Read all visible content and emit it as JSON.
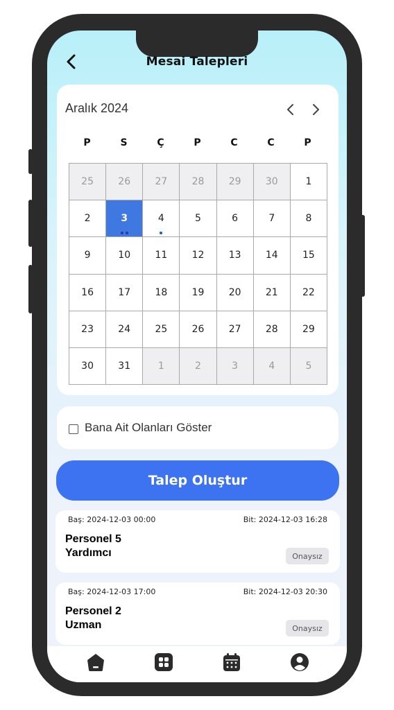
{
  "header": {
    "title": "Mesai Talepleri",
    "back_icon": "back-chevron-icon"
  },
  "calendar": {
    "month_label": "Aralık 2024",
    "prev_icon": "chevron-left-icon",
    "next_icon": "chevron-right-icon",
    "weekdays": [
      "P",
      "S",
      "Ç",
      "P",
      "C",
      "C",
      "P"
    ],
    "days": [
      {
        "label": "25",
        "other": true,
        "dots": 0
      },
      {
        "label": "26",
        "other": true,
        "dots": 0
      },
      {
        "label": "27",
        "other": true,
        "dots": 0
      },
      {
        "label": "28",
        "other": true,
        "dots": 0
      },
      {
        "label": "29",
        "other": true,
        "dots": 0
      },
      {
        "label": "30",
        "other": true,
        "dots": 0
      },
      {
        "label": "1",
        "other": false,
        "dots": 0
      },
      {
        "label": "2",
        "other": false,
        "dots": 0
      },
      {
        "label": "3",
        "other": false,
        "today": true,
        "dots": 2
      },
      {
        "label": "4",
        "other": false,
        "dots": 1
      },
      {
        "label": "5",
        "other": false,
        "dots": 0
      },
      {
        "label": "6",
        "other": false,
        "dots": 0
      },
      {
        "label": "7",
        "other": false,
        "dots": 0
      },
      {
        "label": "8",
        "other": false,
        "dots": 0
      },
      {
        "label": "9",
        "other": false,
        "dots": 0
      },
      {
        "label": "10",
        "other": false,
        "dots": 0
      },
      {
        "label": "11",
        "other": false,
        "dots": 0
      },
      {
        "label": "12",
        "other": false,
        "dots": 0
      },
      {
        "label": "13",
        "other": false,
        "dots": 0
      },
      {
        "label": "14",
        "other": false,
        "dots": 0
      },
      {
        "label": "15",
        "other": false,
        "dots": 0
      },
      {
        "label": "16",
        "other": false,
        "dots": 0
      },
      {
        "label": "17",
        "other": false,
        "dots": 0
      },
      {
        "label": "18",
        "other": false,
        "dots": 0
      },
      {
        "label": "19",
        "other": false,
        "dots": 0
      },
      {
        "label": "20",
        "other": false,
        "dots": 0
      },
      {
        "label": "21",
        "other": false,
        "dots": 0
      },
      {
        "label": "22",
        "other": false,
        "dots": 0
      },
      {
        "label": "23",
        "other": false,
        "dots": 0
      },
      {
        "label": "24",
        "other": false,
        "dots": 0
      },
      {
        "label": "25",
        "other": false,
        "dots": 0
      },
      {
        "label": "26",
        "other": false,
        "dots": 0
      },
      {
        "label": "27",
        "other": false,
        "dots": 0
      },
      {
        "label": "28",
        "other": false,
        "dots": 0
      },
      {
        "label": "29",
        "other": false,
        "dots": 0
      },
      {
        "label": "30",
        "other": false,
        "dots": 0
      },
      {
        "label": "31",
        "other": false,
        "dots": 0
      },
      {
        "label": "1",
        "other": true,
        "dots": 0
      },
      {
        "label": "2",
        "other": true,
        "dots": 0
      },
      {
        "label": "3",
        "other": true,
        "dots": 0
      },
      {
        "label": "4",
        "other": true,
        "dots": 0
      },
      {
        "label": "5",
        "other": true,
        "dots": 0
      }
    ]
  },
  "filter": {
    "label": "Bana Ait Olanları Göster",
    "checked": false
  },
  "create_button": {
    "label": "Talep Oluştur"
  },
  "requests": [
    {
      "start": "Baş: 2024-12-03 00:00",
      "end": "Bit: 2024-12-03 16:28",
      "name_line1": "Personel 5",
      "name_line2": "Yardımcı",
      "status": "Onaysız"
    },
    {
      "start": "Baş: 2024-12-03 17:00",
      "end": "Bit: 2024-12-03 20:30",
      "name_line1": "Personel 2",
      "name_line2": "Uzman",
      "status": "Onaysız"
    }
  ],
  "tabbar": {
    "icons": [
      "home-icon",
      "apps-grid-icon",
      "calendar-icon",
      "profile-icon"
    ]
  },
  "colors": {
    "accent": "#3d72f0",
    "today": "#3f78e0",
    "event_dot": "#1e56d6",
    "frame": "#2b2b2b"
  }
}
